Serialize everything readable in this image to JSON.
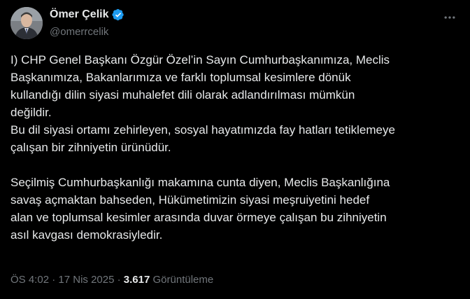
{
  "author": {
    "display_name": "Ömer Çelik",
    "handle": "@omerrcelik",
    "verified_icon": "verified-badge-icon",
    "avatar_icon": "profile-photo-avatar"
  },
  "menu": {
    "more_icon": "more-horizontal-icon"
  },
  "tweet": {
    "text": "I) CHP Genel Başkanı Özgür Özel’in Sayın Cumhurbaşkanımıza, Meclis\nBaşkanımıza, Bakanlarımıza ve farklı toplumsal kesimlere dönük\nkullandığı dilin siyasi muhalefet dili olarak adlandırılması  mümkün\ndeğildir.\nBu dil siyasi ortamı zehirleyen, sosyal hayatımızda fay hatları tetiklemeye\nçalışan bir zihniyetin ürünüdür.\n\nSeçilmiş Cumhurbaşkanlığı makamına cunta diyen, Meclis Başkanlığına\nsavaş açmaktan bahseden,  Hükümetimizin siyasi meşruiyetini hedef\nalan ve toplumsal kesimler arasında duvar örmeye çalışan bu zihniyetin\nasıl kavgası demokrasiyledir."
  },
  "meta": {
    "time": "ÖS 4:02",
    "separator_1": " · ",
    "date": "17 Nis 2025",
    "separator_2": " · ",
    "views_count": "3.617",
    "views_label": " Görüntüleme"
  },
  "colors": {
    "background": "#000000",
    "text_primary": "#e7e9ea",
    "text_secondary": "#71767b",
    "verified_blue": "#1d9bf0"
  }
}
